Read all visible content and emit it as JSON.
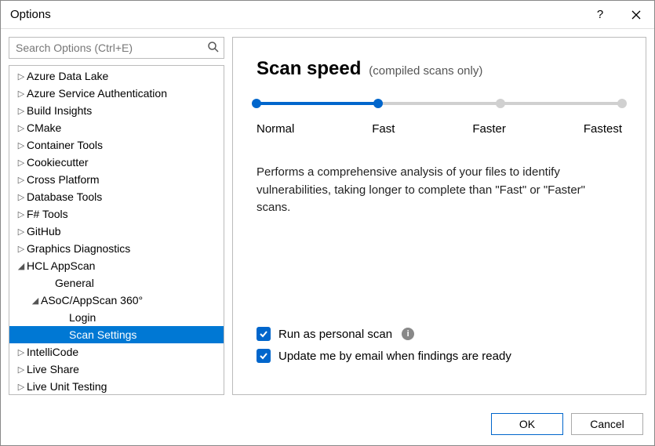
{
  "window": {
    "title": "Options"
  },
  "search": {
    "placeholder": "Search Options (Ctrl+E)"
  },
  "tree": {
    "items": [
      {
        "label": "Azure Data Lake",
        "arrow": "▷",
        "indent": 0
      },
      {
        "label": "Azure Service Authentication",
        "arrow": "▷",
        "indent": 0
      },
      {
        "label": "Build Insights",
        "arrow": "▷",
        "indent": 0
      },
      {
        "label": "CMake",
        "arrow": "▷",
        "indent": 0
      },
      {
        "label": "Container Tools",
        "arrow": "▷",
        "indent": 0
      },
      {
        "label": "Cookiecutter",
        "arrow": "▷",
        "indent": 0
      },
      {
        "label": "Cross Platform",
        "arrow": "▷",
        "indent": 0
      },
      {
        "label": "Database Tools",
        "arrow": "▷",
        "indent": 0
      },
      {
        "label": "F# Tools",
        "arrow": "▷",
        "indent": 0
      },
      {
        "label": "GitHub",
        "arrow": "▷",
        "indent": 0
      },
      {
        "label": "Graphics Diagnostics",
        "arrow": "▷",
        "indent": 0
      },
      {
        "label": "HCL AppScan",
        "arrow": "◢",
        "indent": 0
      },
      {
        "label": "General",
        "arrow": "",
        "indent": 2
      },
      {
        "label": "ASoC/AppScan 360°",
        "arrow": "◢",
        "indent": 1
      },
      {
        "label": "Login",
        "arrow": "",
        "indent": 3
      },
      {
        "label": "Scan Settings",
        "arrow": "",
        "indent": 3,
        "selected": true
      },
      {
        "label": "IntelliCode",
        "arrow": "▷",
        "indent": 0
      },
      {
        "label": "Live Share",
        "arrow": "▷",
        "indent": 0
      },
      {
        "label": "Live Unit Testing",
        "arrow": "▷",
        "indent": 0
      }
    ]
  },
  "panel": {
    "heading": "Scan speed",
    "subheading": "(compiled scans only)",
    "slider": {
      "value_index": 1,
      "stops": [
        "Normal",
        "Fast",
        "Faster",
        "Fastest"
      ]
    },
    "description": "Performs a comprehensive analysis of your files to identify vulnerabilities, taking longer to complete than \"Fast\" or \"Faster\" scans.",
    "check_personal": "Run as personal scan",
    "check_email": "Update me by email when findings are ready"
  },
  "footer": {
    "ok": "OK",
    "cancel": "Cancel"
  }
}
